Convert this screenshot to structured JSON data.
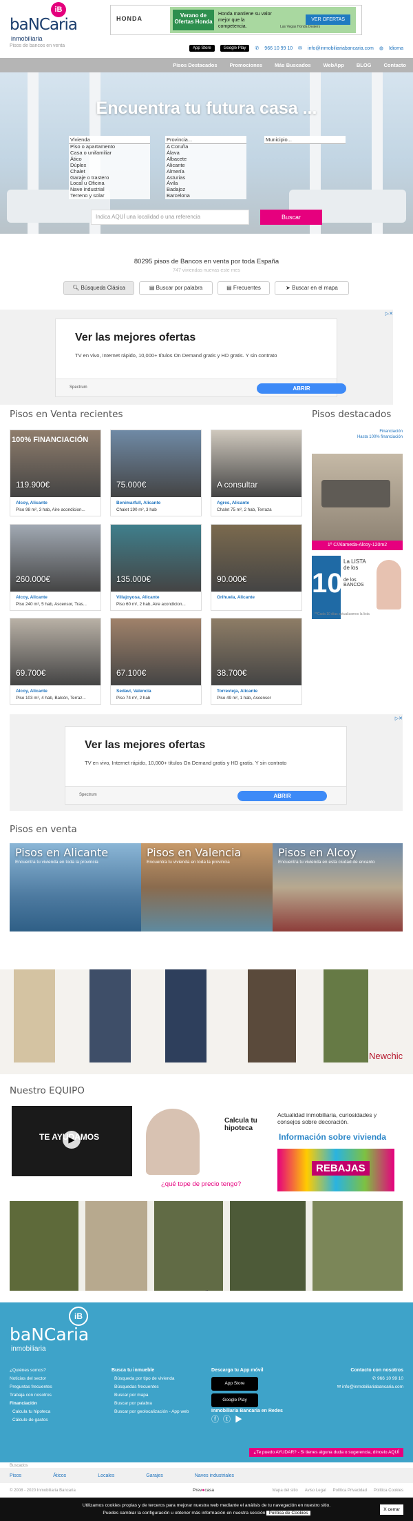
{
  "header": {
    "logo_text": "baNCaria",
    "logo_badge": "iB",
    "logo_sub": "inmobiliaria",
    "tagline": "Pisos de bancos en venta",
    "banner": {
      "brand": "HONDA",
      "tag": "Verano de Ofertas Honda",
      "message": "Honda mantiene su valor mejor que la competencia.",
      "dealer": "Las Vegas Honda Dealers",
      "cta": "VER OFERTAS"
    },
    "app_store": "App Store",
    "google_play": "Google Play",
    "phone": "966 10 99 10",
    "email": "info@inmobiliariabancaria.com",
    "language": "Idioma"
  },
  "nav": {
    "items": [
      "Pisos Destacados",
      "Promociones",
      "Más Buscados",
      "WebApp",
      "BLOG",
      "Contacto"
    ]
  },
  "hero": {
    "title": "Encuentra tu futura casa ...",
    "tipo_head": "Vivienda",
    "tipo_options": [
      "Piso o apartamento",
      "Casa o unifamiliar",
      "Ático",
      "Dúplex",
      "Chalet",
      "Garaje o trastero",
      "Local u Oficina",
      "Nave industrial",
      "Terreno y solar"
    ],
    "provincia_head": "Provincia...",
    "provincia_options": [
      "A Coruña",
      "Álava",
      "Albacete",
      "Alicante",
      "Almería",
      "Asturias",
      "Ávila",
      "Badajoz",
      "Barcelona"
    ],
    "municipio_head": "Municipio...",
    "search_placeholder": "Indica AQUÍ una localidad o una referencia",
    "search_button": "Buscar"
  },
  "stats": {
    "line1": "80295 pisos de Bancos en venta por toda España",
    "line2": "747 viviendas nuevas este mes"
  },
  "search_tabs": [
    "Búsqueda Clásica",
    "Buscar por palabra",
    "Frecuentes",
    "Buscar en el mapa"
  ],
  "ad": {
    "title": "Ver las mejores ofertas",
    "desc": "TV en vivo, Internet rápido, 10,000+ títulos On Demand gratis y HD gratis. Y sin contrato",
    "sponsor": "Spectrum",
    "cta": "ABRIR"
  },
  "recent": {
    "title": "Pisos en Venta recientes",
    "cards": [
      {
        "price": "119.900€",
        "location": "Alcoy, Alicante",
        "info": "Piso 98 m², 3 hab, Aire acondicion...",
        "badge": "100% FINANCIACIÓN",
        "color": "#8f7d6c"
      },
      {
        "price": "75.000€",
        "location": "Benimarfull, Alicante",
        "info": "Chalet 190 m², 3 hab",
        "badge": "",
        "color": "#6f8aa6"
      },
      {
        "price": "A consultar",
        "location": "Agres, Alicante",
        "info": "Chalet 75 m², 2 hab, Terraza",
        "badge": "",
        "color": "#cfc8bd"
      },
      {
        "price": "260.000€",
        "location": "Alcoy, Alicante",
        "info": "Piso 240 m², 5 hab, Ascensor, Tras...",
        "badge": "",
        "color": "#a1a9b3"
      },
      {
        "price": "135.000€",
        "location": "Villajoyosa, Alicante",
        "info": "Piso 60 m², 2 hab, Aire acondicion...",
        "badge": "",
        "color": "#3f7f8c"
      },
      {
        "price": "90.000€",
        "location": "Orihuela, Alicante",
        "info": "",
        "badge": "",
        "color": "#7b6a4e"
      },
      {
        "price": "69.700€",
        "location": "Alcoy, Alicante",
        "info": "Piso 103 m², 4 hab, Balcón, Terraz...",
        "badge": "",
        "color": "#b9b1a6"
      },
      {
        "price": "67.100€",
        "location": "Sedaví, Valencia",
        "info": "Piso 74 m², 2 hab",
        "badge": "",
        "color": "#a0826a"
      },
      {
        "price": "38.700€",
        "location": "Torrevieja, Alicante",
        "info": "Piso 49 m², 1 hab, Ascensor",
        "badge": "",
        "color": "#8e7d66"
      }
    ]
  },
  "featured": {
    "title": "Pisos destacados",
    "note1": "Financiación",
    "note2": "Hasta 100% financiación",
    "caption": "1º C/Alameda-Alcoy-120m2",
    "list_title": "La LISTA de los",
    "list_sub": "de los BANCOS",
    "list_note": "**Cada 10 días actualizamos la lista"
  },
  "pisos_venta": {
    "title": "Pisos en venta",
    "cities": [
      {
        "name": "Pisos en Alicante",
        "sub": "Encuentra tu vivienda en toda la provincia"
      },
      {
        "name": "Pisos en Valencia",
        "sub": "Encuentra tu vivienda en toda la provincia"
      },
      {
        "name": "Pisos en Alcoy",
        "sub": "Encuentra tu vivienda en esta ciudad de encanto"
      }
    ]
  },
  "fashion_ad": {
    "brand": "Newchic"
  },
  "team": {
    "title": "Nuestro EQUIPO",
    "video_text": "TE AYUDAMOS",
    "calc_title": "Calcula tu hipoteca",
    "calc_question": "¿qué tope de precio tengo?",
    "info_text": "Actualidad inmobiliaria, curiosidades y consejos sobre decoración.",
    "info_title": "Información sobre vivienda",
    "rebajas": "REBAJAS"
  },
  "footer": {
    "logo_text": "baNCaria",
    "logo_sub": "inmobiliaria",
    "col1": [
      "¿Quiénes somos?",
      "Noticias del sector",
      "Preguntas frecuentes",
      "Trabaja con nosotros",
      "Financiación",
      "Calcula tu hipoteca",
      "Cálculo de gastos"
    ],
    "col2_title": "Busca tu inmueble",
    "col2": [
      "Búsqueda por tipo de vivienda",
      "Búsquedas frecuentes",
      "Buscar por mapa",
      "Buscar por palabra",
      "Buscar por geolocalización - App web"
    ],
    "col3_title": "Descarga tu App móvil",
    "col3_social": "Inmobiliaria Bancaria en Redes",
    "col4_title": "Contacto con nosotros",
    "phone": "966 10 99 10",
    "email": "info@inmobiliariabancaria.com",
    "help": "¿Te puedo AYUDAR? - Si tienes alguna duda o sugerencia, díncelo AQUÍ"
  },
  "bottom": {
    "searched": "Buscados",
    "links": [
      "Pisos",
      "Áticos",
      "Locales",
      "Garajes",
      "Naves industriales"
    ],
    "copyright": "© 2008 - 2020 Inmobiliaria Bancaria",
    "legal": [
      "Mapa del sitio",
      "Aviso Legal",
      "Política Privacidad",
      "Política Cookies"
    ]
  },
  "cookies": {
    "text1": "Utilizamos cookies propias y de terceros para mejorar nuestra web mediante el análisis de tu navegación en nuestro sitio.",
    "text2": "Puedes cambiar la configuración u obtener más información en nuestra sección",
    "link": "Política de Cookies",
    "close": "X cerrar"
  }
}
